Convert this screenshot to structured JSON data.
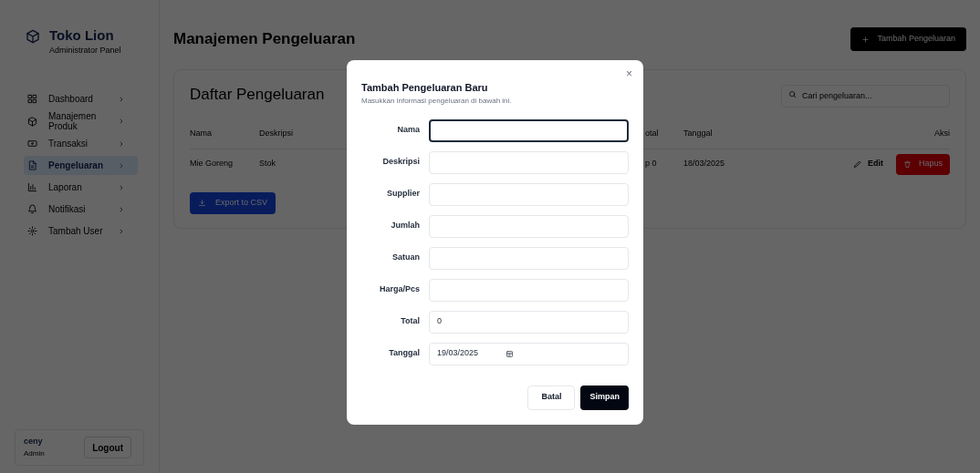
{
  "sidebar": {
    "brand": "Toko Lion",
    "subtitle": "Administrator Panel",
    "items": [
      {
        "label": "Dashboard",
        "selected": false
      },
      {
        "label": "Manajemen Produk",
        "selected": false
      },
      {
        "label": "Transaksi",
        "selected": false
      },
      {
        "label": "Pengeluaran",
        "selected": true
      },
      {
        "label": "Laporan",
        "selected": false
      },
      {
        "label": "Notifikasi",
        "selected": false
      },
      {
        "label": "Tambah User",
        "selected": false
      }
    ],
    "user": {
      "name": "ceny",
      "role": "Admin"
    },
    "logout": "Logout"
  },
  "header": {
    "title": "Manajemen Pengeluaran",
    "add_button": "Tambah Pengeluaran"
  },
  "card": {
    "title": "Daftar Pengeluaran",
    "search": {
      "placeholder": "Cari pengeluaran..."
    },
    "columns": [
      "Nama",
      "Deskripsi",
      "otal",
      "Tanggal",
      "Aksi"
    ],
    "rows": [
      {
        "cells": [
          "Mie Goreng",
          "Stok",
          "p 0",
          "18/03/2025"
        ],
        "edit": "Edit",
        "delete": "Hapus"
      }
    ],
    "export_button": "Export to CSV"
  },
  "dialog": {
    "title": "Tambah Pengeluaran Baru",
    "subtitle": "Masukkan informasi pengeluaran di bawah ini.",
    "close": "×",
    "fields": [
      {
        "label": "Nama",
        "kind": "text",
        "focused": true
      },
      {
        "label": "Deskripsi",
        "kind": "text",
        "focused": false
      },
      {
        "label": "Supplier",
        "kind": "text",
        "focused": false
      },
      {
        "label": "Jumlah",
        "kind": "text",
        "focused": false
      },
      {
        "label": "Satuan",
        "kind": "text",
        "focused": false
      },
      {
        "label": "Harga/Pcs",
        "kind": "text",
        "focused": false
      },
      {
        "label": "Total",
        "kind": "text",
        "value": "0",
        "focused": false
      },
      {
        "label": "Tanggal",
        "kind": "date",
        "value": "19/03/2025",
        "focused": false
      }
    ],
    "cancel": "Batal",
    "submit": "Simpan"
  }
}
